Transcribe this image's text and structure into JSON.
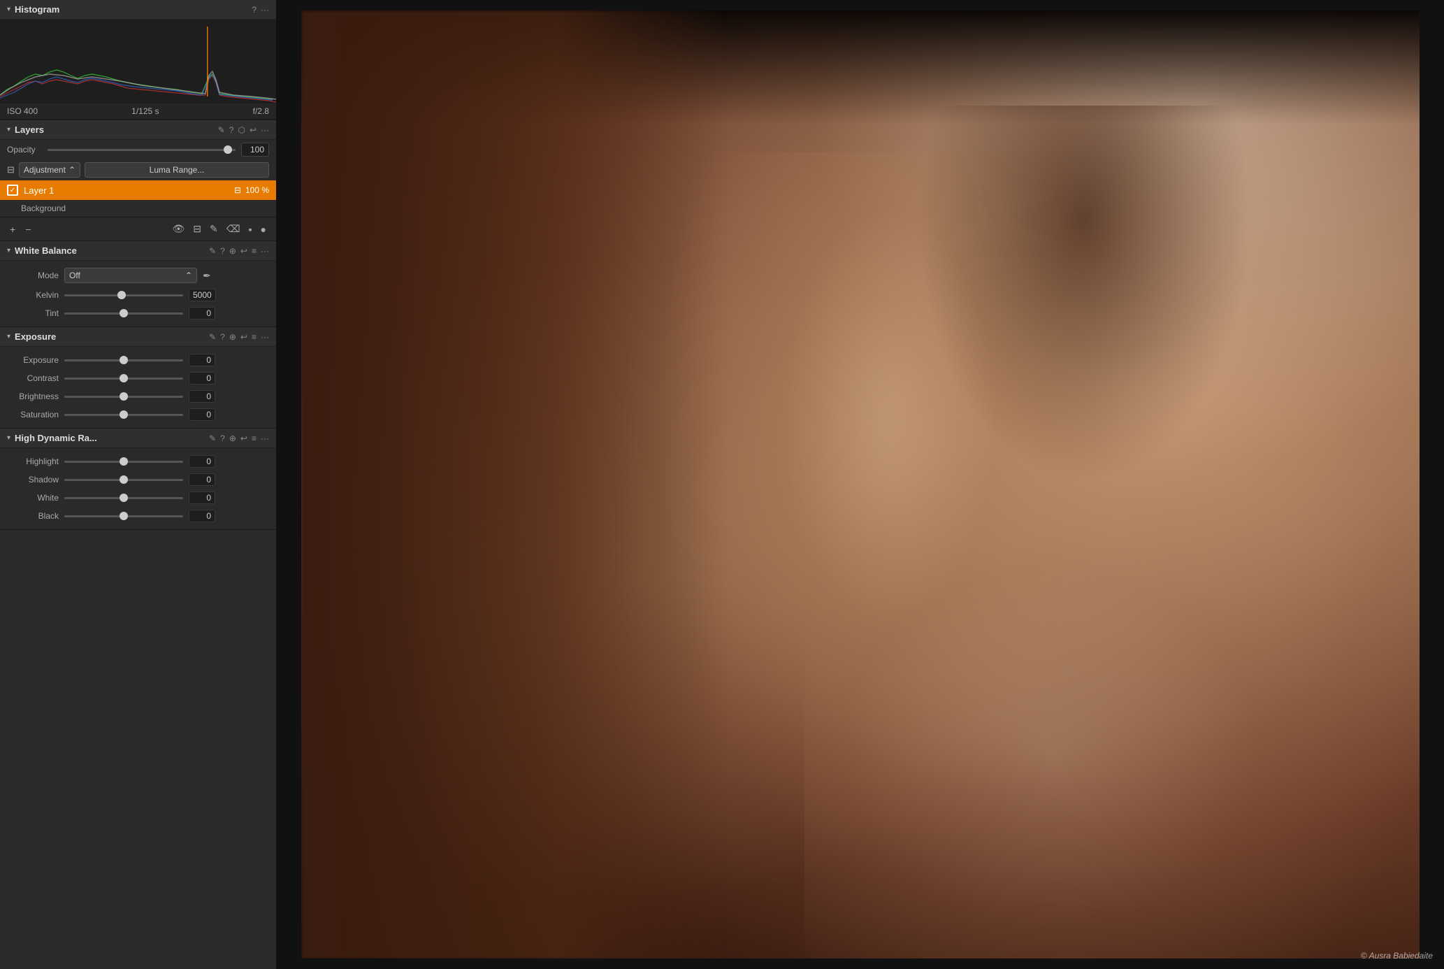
{
  "histogram": {
    "title": "Histogram",
    "iso": "ISO 400",
    "shutter": "1/125 s",
    "aperture": "f/2.8"
  },
  "layers": {
    "title": "Layers",
    "opacity_label": "Opacity",
    "opacity_value": "100",
    "opacity_percent": "100",
    "adjustment_label": "Adjustment",
    "adjustment_arrow": "⌃",
    "luma_range_btn": "Luma Range...",
    "layer1_name": "Layer 1",
    "layer1_percent": "100 %",
    "background_label": "Background",
    "add_btn": "+",
    "remove_btn": "−"
  },
  "white_balance": {
    "title": "White Balance",
    "mode_label": "Mode",
    "mode_value": "Off",
    "kelvin_label": "Kelvin",
    "kelvin_value": "5000",
    "kelvin_thumb_pct": "48",
    "tint_label": "Tint",
    "tint_value": "0",
    "tint_thumb_pct": "50"
  },
  "exposure": {
    "title": "Exposure",
    "exposure_label": "Exposure",
    "exposure_value": "0",
    "exposure_thumb_pct": "50",
    "contrast_label": "Contrast",
    "contrast_value": "0",
    "contrast_thumb_pct": "50",
    "brightness_label": "Brightness",
    "brightness_value": "0",
    "brightness_thumb_pct": "50",
    "saturation_label": "Saturation",
    "saturation_value": "0",
    "saturation_thumb_pct": "50"
  },
  "hdr": {
    "title": "High Dynamic Ra...",
    "highlight_label": "Highlight",
    "highlight_value": "0",
    "highlight_thumb_pct": "50",
    "shadow_label": "Shadow",
    "shadow_value": "0",
    "shadow_thumb_pct": "50",
    "white_label": "White",
    "white_value": "0",
    "white_thumb_pct": "50",
    "black_label": "Black",
    "black_value": "0",
    "black_thumb_pct": "50"
  },
  "copyright": "© Ausra Babiedaite",
  "icons": {
    "question": "?",
    "ellipsis": "···",
    "pencil": "✎",
    "undo": "↩",
    "menu": "≡",
    "eye": "👁",
    "sliders": "⊟",
    "brush": "⌀",
    "eraser": "⌫",
    "square": "▪",
    "circle": "●",
    "pin": "⊕",
    "arrow": "↩",
    "chevron_down": "▾",
    "eyedropper": "✒"
  }
}
